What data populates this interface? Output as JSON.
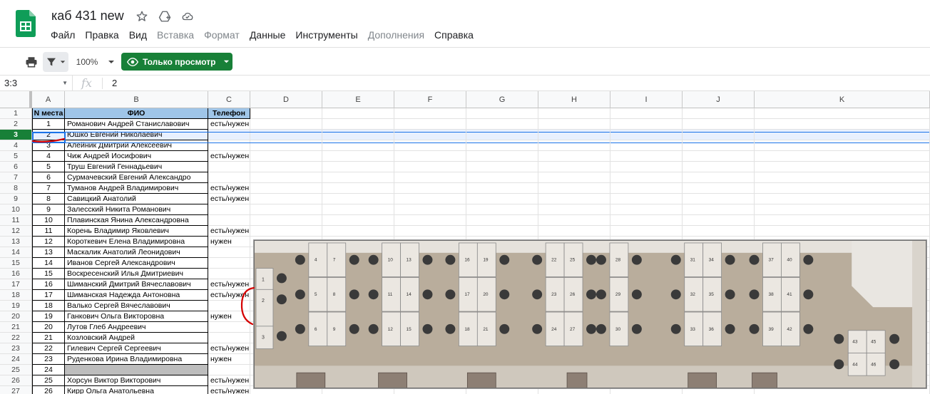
{
  "doc": {
    "title": "каб 431 new"
  },
  "menu": [
    {
      "label": "Файл",
      "disabled": false
    },
    {
      "label": "Правка",
      "disabled": false
    },
    {
      "label": "Вид",
      "disabled": false
    },
    {
      "label": "Вставка",
      "disabled": true
    },
    {
      "label": "Формат",
      "disabled": true
    },
    {
      "label": "Данные",
      "disabled": false
    },
    {
      "label": "Инструменты",
      "disabled": false
    },
    {
      "label": "Дополнения",
      "disabled": true
    },
    {
      "label": "Справка",
      "disabled": false
    }
  ],
  "toolbar": {
    "zoom": "100%",
    "view_only": "Только просмотр"
  },
  "formula": {
    "name_box": "3:3",
    "fx": "fx",
    "value": "2"
  },
  "columns": [
    "A",
    "B",
    "C",
    "D",
    "E",
    "F",
    "G",
    "H",
    "I",
    "J",
    "K"
  ],
  "header_row": {
    "a": "N места",
    "b": "ФИО",
    "c": "Телефон"
  },
  "rows": [
    {
      "n": "1",
      "num": "1",
      "name": "Романович Андрей Станиславович",
      "phone": "есть/нужен"
    },
    {
      "n": "2",
      "num": "2",
      "name": "Юшко Евгений Николаевич",
      "phone": ""
    },
    {
      "n": "3",
      "num": "3",
      "name": "Алейник Дмитрий Алексеевич",
      "phone": ""
    },
    {
      "n": "4",
      "num": "4",
      "name": "Чиж Андрей Иосифович",
      "phone": "есть/нужен"
    },
    {
      "n": "5",
      "num": "5",
      "name": "Труш Евгений Геннадьевич",
      "phone": ""
    },
    {
      "n": "6",
      "num": "6",
      "name": "Сурмачевский Евгений Александро",
      "phone": ""
    },
    {
      "n": "7",
      "num": "7",
      "name": "Туманов Андрей Владимирович",
      "phone": "есть/нужен"
    },
    {
      "n": "8",
      "num": "8",
      "name": "Савицкий Анатолий",
      "phone": "есть/нужен"
    },
    {
      "n": "9",
      "num": "9",
      "name": "Залесский Никита Романович",
      "phone": ""
    },
    {
      "n": "10",
      "num": "10",
      "name": "Плавинская Янина Александровна",
      "phone": ""
    },
    {
      "n": "11",
      "num": "11",
      "name": "Корень Владимир Яковлевич",
      "phone": "есть/нужен"
    },
    {
      "n": "12",
      "num": "12",
      "name": "Короткевич Елена Владимировна",
      "phone": "нужен"
    },
    {
      "n": "13",
      "num": "13",
      "name": "Маскалик Анатолий Леонидович",
      "phone": ""
    },
    {
      "n": "14",
      "num": "14",
      "name": "Иванов Сергей Александрович",
      "phone": ""
    },
    {
      "n": "15",
      "num": "15",
      "name": "Воскресенский Илья Дмитриевич",
      "phone": ""
    },
    {
      "n": "16",
      "num": "16",
      "name": "Шиманский Дмитрий Вячеславович",
      "phone": "есть/нужен"
    },
    {
      "n": "17",
      "num": "17",
      "name": "Шиманская Надежда Антоновна",
      "phone": "есть/нужен"
    },
    {
      "n": "18",
      "num": "18",
      "name": "Валько Сергей Вячеславович",
      "phone": ""
    },
    {
      "n": "19",
      "num": "19",
      "name": "Ганкович Ольга Викторовна",
      "phone": "нужен"
    },
    {
      "n": "20",
      "num": "20",
      "name": "Лутов Глеб Андреевич",
      "phone": ""
    },
    {
      "n": "21",
      "num": "21",
      "name": "Козловский Андрей",
      "phone": ""
    },
    {
      "n": "22",
      "num": "22",
      "name": "Гилевич Сергей Сергеевич",
      "phone": "есть/нужен"
    },
    {
      "n": "23",
      "num": "23",
      "name": "Руденкова Ирина Владимировна",
      "phone": "нужен"
    },
    {
      "n": "24",
      "num": "24",
      "name": "",
      "phone": ""
    },
    {
      "n": "25",
      "num": "25",
      "name": "Хорсун Виктор Викторович",
      "phone": "есть/нужен"
    },
    {
      "n": "26",
      "num": "26",
      "name": "Кирр Ольга Анатольевна",
      "phone": "есть/нужен"
    }
  ],
  "floorplan": {
    "desks": [
      "1",
      "2",
      "3",
      "4",
      "5",
      "6",
      "7",
      "8",
      "9",
      "10",
      "11",
      "12",
      "13",
      "14",
      "15",
      "16",
      "17",
      "18",
      "19",
      "20",
      "21",
      "22",
      "23",
      "24",
      "25",
      "26",
      "27",
      "28",
      "29",
      "30",
      "31",
      "32",
      "33",
      "34",
      "35",
      "36",
      "37",
      "38",
      "39",
      "40",
      "41",
      "42",
      "43",
      "44",
      "45",
      "46"
    ]
  },
  "colors": {
    "accent": "#188038",
    "header_fill": "#9fc5e8",
    "selection": "#1a73e8",
    "annotation": "#d50000"
  }
}
